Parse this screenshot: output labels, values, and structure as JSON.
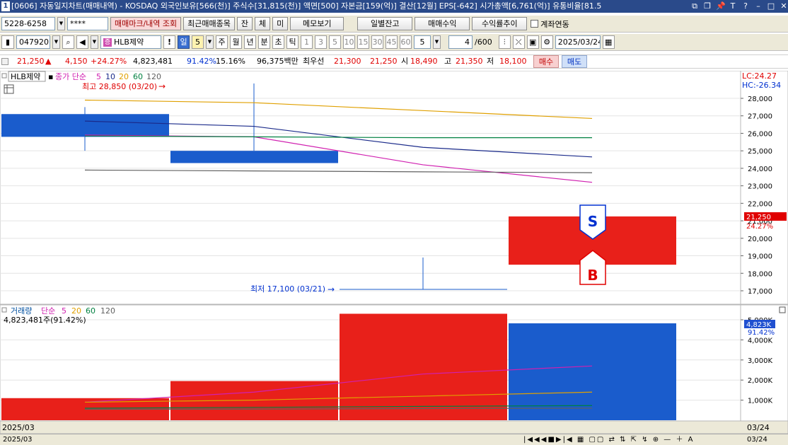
{
  "titlebar": {
    "index": "1",
    "text": "[0606] 자동일지차트(매매내역) - KOSDAQ 외국인보유[566(천)] 주식수[31,815(천)] 액면[500] 자본금[159(억)] 결산[12월] EPS[-642] 시가총액[6,761(억)] 유통비율[81.5"
  },
  "toolbar1": {
    "account": "5228-6258",
    "password": "****",
    "btn_trade_mark": "매매마크/내역 조회",
    "btn_recent_trades": "최근매매종목",
    "btn_jan": "잔",
    "btn_che": "체",
    "btn_mi": "미",
    "btn_memo": "메모보기",
    "btn_daily_balance": "일별잔고",
    "btn_trade_profit": "매매수익",
    "btn_return_trend": "수익률추이",
    "account_link_label": "계좌연동"
  },
  "toolbar2": {
    "code": "047920",
    "stock_name": "HLB제약",
    "period_day": "일",
    "period_count": "5",
    "periods": [
      "주",
      "월",
      "년",
      "분",
      "초",
      "틱"
    ],
    "intervals": [
      "1",
      "3",
      "5",
      "10",
      "15",
      "30",
      "45",
      "60"
    ],
    "interval_select": "5",
    "count": "4",
    "count_total": "/600",
    "date": "2025/03/24"
  },
  "quote": {
    "price": "21,250",
    "change": "4,150",
    "change_pct": "+24.27%",
    "volume": "4,823,481",
    "vol_ratio": "91.42%",
    "turnover": "15.16%",
    "amount": "96,375백만",
    "best_ask_label": "최우선",
    "ask": "21,300",
    "bid": "21,250",
    "open_label": "시",
    "open": "18,490",
    "high_label": "고",
    "high": "21,350",
    "low_label": "저",
    "low": "18,100",
    "buy_btn": "매수",
    "sell_btn": "매도"
  },
  "price_panel": {
    "stock_tag": "HLB제약",
    "legend_label": "종가 단순",
    "ma_periods": [
      "5",
      "10",
      "20",
      "60",
      "120"
    ],
    "ma_colors": [
      "#d020b0",
      "#1a2a8a",
      "#e0a000",
      "#008040",
      "#606060"
    ],
    "lc": "LC:24.27",
    "hc": "HC:-26.34",
    "high_note": "최고 28,850 (03/20)",
    "low_note": "최저 17,100 (03/21)",
    "last_price": "21,250",
    "last_pct": "24.27%",
    "sell_marker": "S",
    "buy_marker": "B",
    "yticks": [
      "28,000",
      "27,000",
      "26,000",
      "25,000",
      "24,000",
      "23,000",
      "22,000",
      "21,000",
      "20,000",
      "19,000",
      "18,000",
      "17,000"
    ]
  },
  "volume_panel": {
    "legend_label": "거래량",
    "legend_ma": "단순",
    "ma_periods": [
      "5",
      "20",
      "60",
      "120"
    ],
    "ma_colors": [
      "#d020b0",
      "#e0a000",
      "#008040",
      "#606060"
    ],
    "info": "4,823,481주(91.42%)",
    "last_vol": "4,823K",
    "last_pct": "91.42%",
    "yticks": [
      "5,000K",
      "4,000K",
      "3,000K",
      "2,000K",
      "1,000K"
    ]
  },
  "chart_data": {
    "type": "candlestick",
    "dates": [
      "03/20",
      "03/21",
      "03/21",
      "03/24"
    ],
    "candles": [
      {
        "open": 27100,
        "high": 27500,
        "low": 25000,
        "close": 25800,
        "color": "blue"
      },
      {
        "open": 25000,
        "high": 28850,
        "low": 25000,
        "close": 24300,
        "color": "blue"
      },
      {
        "open": 17100,
        "high": 18900,
        "low": 17100,
        "close": 17100,
        "color": "blue"
      },
      {
        "open": 18490,
        "high": 21350,
        "low": 18100,
        "close": 21250,
        "color": "red"
      }
    ],
    "volume": [
      1100,
      1950,
      5300,
      4823
    ],
    "volume_colors": [
      "red",
      "red",
      "red",
      "blue"
    ],
    "ma_price": {
      "5": [
        25900,
        25800,
        24200,
        23200
      ],
      "10": [
        26700,
        26400,
        25200,
        24650
      ],
      "20": [
        27900,
        27750,
        27300,
        26850
      ],
      "60": [
        25850,
        25800,
        25750,
        25750
      ],
      "120": [
        23900,
        23850,
        23800,
        23750
      ]
    },
    "ma_volume": {
      "5": [
        900,
        1400,
        2300,
        2700
      ],
      "20": [
        900,
        1000,
        1200,
        1400
      ],
      "60": [
        600,
        640,
        690,
        730
      ],
      "120": [
        550,
        560,
        580,
        600
      ]
    },
    "x_start_label": "2025/03",
    "x_end_label": "03/24"
  },
  "statusbar": {
    "left": "2025/03",
    "right": "03/24"
  }
}
